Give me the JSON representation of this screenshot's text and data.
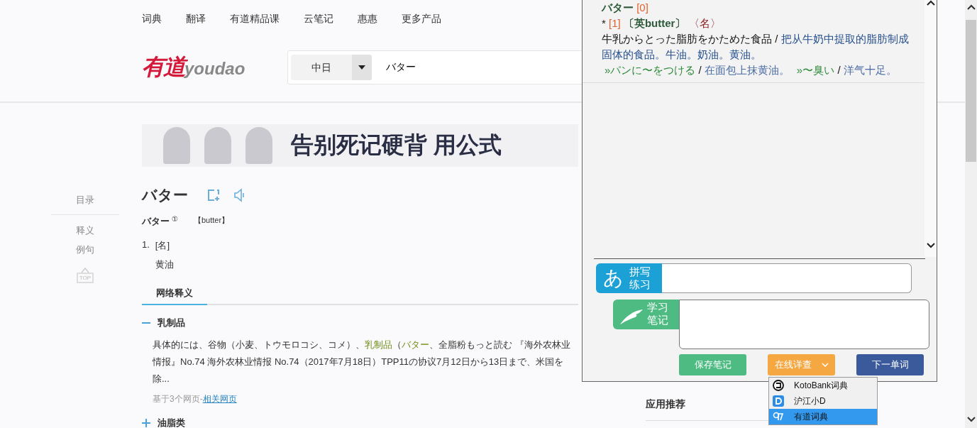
{
  "nav": [
    "词典",
    "翻译",
    "有道精品课",
    "云笔记",
    "惠惠",
    "更多产品"
  ],
  "logo": {
    "cn": "有道",
    "en": "youdao"
  },
  "search": {
    "language": "中日",
    "value": "バター"
  },
  "banner": {
    "headline": "告别死记硬背 用公式"
  },
  "toc": {
    "title": "目录",
    "items": [
      "释义",
      "例句"
    ],
    "top_label": "TOP"
  },
  "entry": {
    "word": "バター",
    "sub_word": "バター",
    "sub_mark": "①",
    "origin": "【butter】",
    "senses": [
      {
        "number": "1.",
        "pos": "[名]",
        "meaning": "黄油"
      }
    ]
  },
  "tabs": [
    {
      "label": "网络释义",
      "selected": true
    }
  ],
  "web_defs": [
    {
      "term": "乳制品",
      "expanded": true,
      "segments": [
        {
          "text": "具体的には、谷物（小麦、トウモロコシ、コメ）、",
          "highlight": false
        },
        {
          "text": "乳制品",
          "highlight": true
        },
        {
          "text": "（",
          "highlight": false
        },
        {
          "text": "バター",
          "highlight": true
        },
        {
          "text": "、全脂粉もっと読む 『海外农林业情报』No.74 海外农林业情报 No.74（2017年7月18日）TPP11の协议7月12日から13日まで、米国を除...",
          "highlight": false
        }
      ],
      "source": "基于3个网页-",
      "source_link": "相关网页"
    },
    {
      "term": "油脂类",
      "expanded": false
    }
  ],
  "side_heading": "应用推荐",
  "popup": {
    "header": {
      "word": "バター",
      "index": "[0]"
    },
    "sense": {
      "marker": "*",
      "number": "[1]",
      "origin": "〔英butter〕",
      "pos": "〈名〉"
    },
    "definition": {
      "jp": "牛乳からとった脂肪をかためた食品",
      "separator": "/",
      "cn": "把从牛奶中提取的脂肪制成固体的食品。牛油。奶油。黄油。"
    },
    "examples": [
      {
        "marker": "»",
        "jp": "パンに〜をつける",
        "separator": "/",
        "cn": "在面包上抹黄油。"
      },
      {
        "marker": "»",
        "jp": "〜臭い",
        "separator": "/",
        "cn": "洋气十足。"
      }
    ],
    "spelling": {
      "glyph": "あ",
      "label": "拼写练习"
    },
    "notes": {
      "label": "学习笔记"
    },
    "buttons": [
      {
        "label": "保存笔记",
        "kind": "save"
      },
      {
        "label": "在线详查",
        "kind": "dropdown"
      },
      {
        "label": "下一单词",
        "kind": "next"
      }
    ],
    "menu": [
      {
        "label": "KotoBank词典",
        "kind": "kotobank",
        "selected": false
      },
      {
        "label": "沪江小D",
        "kind": "hujiang",
        "selected": false
      },
      {
        "label": "有道词典",
        "kind": "youdao",
        "selected": true
      }
    ]
  }
}
